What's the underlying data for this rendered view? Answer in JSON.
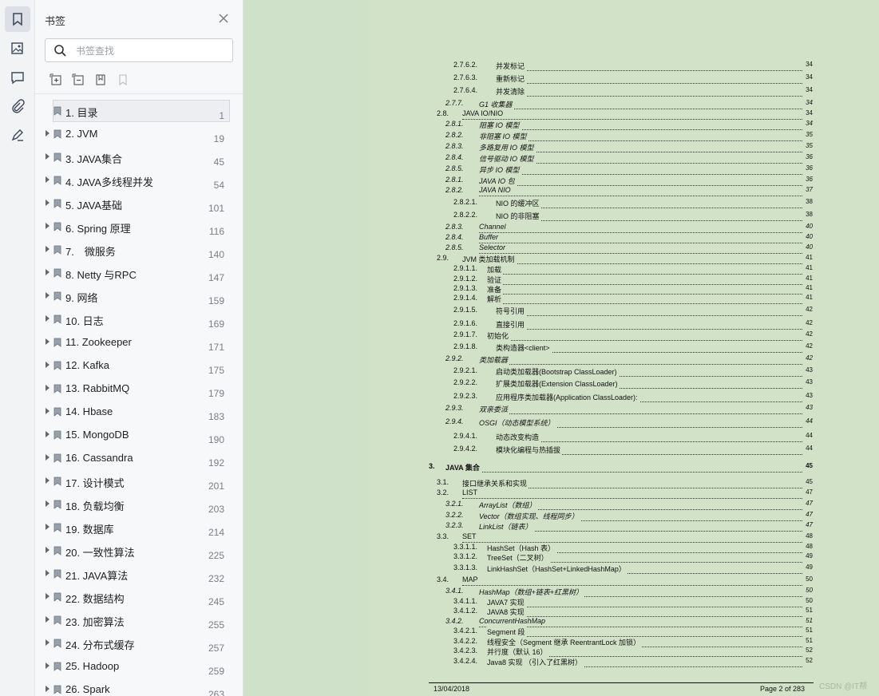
{
  "sidebar_panel": {
    "title": "书签",
    "search_placeholder": "书签查找",
    "bookmarks": [
      {
        "label": "1. 目录",
        "page": "1"
      },
      {
        "label": "2. JVM",
        "page": "19"
      },
      {
        "label": "3. JAVA集合",
        "page": "45"
      },
      {
        "label": "4. JAVA多线程并发",
        "page": "54"
      },
      {
        "label": "5. JAVA基础",
        "page": "101"
      },
      {
        "label": "6. Spring 原理",
        "page": "116"
      },
      {
        "label": "7.　微服务",
        "page": "140"
      },
      {
        "label": "8. Netty 与RPC",
        "page": "147"
      },
      {
        "label": "9. 网络",
        "page": "159"
      },
      {
        "label": "10. 日志",
        "page": "169"
      },
      {
        "label": "11. Zookeeper",
        "page": "171"
      },
      {
        "label": "12. Kafka",
        "page": "175"
      },
      {
        "label": "13. RabbitMQ",
        "page": "179"
      },
      {
        "label": "14. Hbase",
        "page": "183"
      },
      {
        "label": "15. MongoDB",
        "page": "190"
      },
      {
        "label": "16. Cassandra",
        "page": "192"
      },
      {
        "label": "17. 设计模式",
        "page": "201"
      },
      {
        "label": "18. 负载均衡",
        "page": "203"
      },
      {
        "label": "19. 数据库",
        "page": "214"
      },
      {
        "label": "20. 一致性算法",
        "page": "225"
      },
      {
        "label": "21. JAVA算法",
        "page": "232"
      },
      {
        "label": "22. 数据结构",
        "page": "245"
      },
      {
        "label": "23. 加密算法",
        "page": "255"
      },
      {
        "label": "24. 分布式缓存",
        "page": "257"
      },
      {
        "label": "25. Hadoop",
        "page": "259"
      },
      {
        "label": "26. Spark",
        "page": "263"
      }
    ]
  },
  "document": {
    "toc": [
      {
        "num": "2.7.6.2.",
        "title": "并发标记",
        "page": "34",
        "lvl": 4
      },
      {
        "num": "2.7.6.3.",
        "title": "重新标记",
        "page": "34",
        "lvl": 4
      },
      {
        "num": "2.7.6.4.",
        "title": "并发清除",
        "page": "34",
        "lvl": 4
      },
      {
        "num": "2.7.7.",
        "title": "G1 收集器",
        "page": "34",
        "lvl": 3,
        "italic": true
      },
      {
        "num": "2.8.",
        "title": "JAVA IO/NIO",
        "page": "34",
        "lvl": 2
      },
      {
        "num": "2.8.1.",
        "title": "阻塞 IO 模型",
        "page": "34",
        "lvl": 3,
        "italic": true
      },
      {
        "num": "2.8.2.",
        "title": "非阻塞 IO 模型",
        "page": "35",
        "lvl": 3,
        "italic": true
      },
      {
        "num": "2.8.3.",
        "title": "多路复用 IO 模型",
        "page": "35",
        "lvl": 3,
        "italic": true
      },
      {
        "num": "2.8.4.",
        "title": "信号驱动 IO 模型",
        "page": "36",
        "lvl": 3,
        "italic": true
      },
      {
        "num": "2.8.5.",
        "title": "异步 IO 模型",
        "page": "36",
        "lvl": 3,
        "italic": true
      },
      {
        "num": "2.8.1.",
        "title": "JAVA IO 包",
        "page": "36",
        "lvl": 3,
        "italic": true
      },
      {
        "num": "2.8.2.",
        "title": "JAVA NIO",
        "page": "37",
        "lvl": 3,
        "italic": true
      },
      {
        "num": "2.8.2.1.",
        "title": "NIO 的缓冲区",
        "page": "38",
        "lvl": 4
      },
      {
        "num": "2.8.2.2.",
        "title": "NIO 的非阻塞",
        "page": "38",
        "lvl": 4
      },
      {
        "num": "2.8.3.",
        "title": "Channel",
        "page": "40",
        "lvl": 3,
        "italic": true
      },
      {
        "num": "2.8.4.",
        "title": "Buffer",
        "page": "40",
        "lvl": 3,
        "italic": true
      },
      {
        "num": "2.8.5.",
        "title": "Selector",
        "page": "40",
        "lvl": 3,
        "italic": true
      },
      {
        "num": "2.9.",
        "title": "JVM 类加载机制",
        "page": "41",
        "lvl": 2
      },
      {
        "num": "2.9.1.1.",
        "title": "加载",
        "page": "41",
        "lvl": 4,
        "tight": true
      },
      {
        "num": "2.9.1.2.",
        "title": "验证",
        "page": "41",
        "lvl": 4,
        "tight": true
      },
      {
        "num": "2.9.1.3.",
        "title": "准备",
        "page": "41",
        "lvl": 4,
        "tight": true
      },
      {
        "num": "2.9.1.4.",
        "title": "解析",
        "page": "41",
        "lvl": 4,
        "tight": true
      },
      {
        "num": "2.9.1.5.",
        "title": "符号引用",
        "page": "42",
        "lvl": 4
      },
      {
        "num": "2.9.1.6.",
        "title": "直接引用",
        "page": "42",
        "lvl": 4
      },
      {
        "num": "2.9.1.7.",
        "title": "初始化",
        "page": "42",
        "lvl": 4,
        "tight": true
      },
      {
        "num": "2.9.1.8.",
        "title": "类构造器<client>",
        "page": "42",
        "lvl": 4
      },
      {
        "num": "2.9.2.",
        "title": "类加载器",
        "page": "42",
        "lvl": 3,
        "italic": true
      },
      {
        "num": "2.9.2.1.",
        "title": "启动类加载器(Bootstrap ClassLoader)",
        "page": "43",
        "lvl": 4
      },
      {
        "num": "2.9.2.2.",
        "title": "扩展类加载器(Extension ClassLoader)",
        "page": "43",
        "lvl": 4
      },
      {
        "num": "2.9.2.3.",
        "title": "应用程序类加载器(Application ClassLoader):",
        "page": "43",
        "lvl": 4
      },
      {
        "num": "2.9.3.",
        "title": "双亲委派",
        "page": "43",
        "lvl": 3,
        "italic": true
      },
      {
        "num": "2.9.4.",
        "title": "OSGI（动态模型系统）",
        "page": "44",
        "lvl": 3,
        "italic": true
      },
      {
        "num": "2.9.4.1.",
        "title": "动态改变构造",
        "page": "44",
        "lvl": 4
      },
      {
        "num": "2.9.4.2.",
        "title": "模块化编程与热插拔",
        "page": "44",
        "lvl": 4
      },
      {
        "num": "3.",
        "title": "JAVA 集合",
        "page": "45",
        "lvl": 1,
        "bold": true
      },
      {
        "num": "3.1.",
        "title": "接口继承关系和实现",
        "page": "45",
        "lvl": 2
      },
      {
        "num": "3.2.",
        "title": "LIST",
        "page": "47",
        "lvl": 2
      },
      {
        "num": "3.2.1.",
        "title": "ArrayList（数组）",
        "page": "47",
        "lvl": 3,
        "italic": true
      },
      {
        "num": "3.2.2.",
        "title": "Vector（数组实现、线程同步）",
        "page": "47",
        "lvl": 3,
        "italic": true
      },
      {
        "num": "3.2.3.",
        "title": "LinkList（链表）",
        "page": "47",
        "lvl": 3,
        "italic": true
      },
      {
        "num": "3.3.",
        "title": "SET",
        "page": "48",
        "lvl": 2
      },
      {
        "num": "3.3.1.1.",
        "title": "HashSet（Hash 表）",
        "page": "48",
        "lvl": 4,
        "tight": true
      },
      {
        "num": "3.3.1.2.",
        "title": "TreeSet（二叉树）",
        "page": "49",
        "lvl": 4,
        "tight": true
      },
      {
        "num": "3.3.1.3.",
        "title": "LinkHashSet（HashSet+LinkedHashMap）",
        "page": "49",
        "lvl": 4,
        "tight": true
      },
      {
        "num": "3.4.",
        "title": "MAP",
        "page": "50",
        "lvl": 2
      },
      {
        "num": "3.4.1.",
        "title": "HashMap（数组+链表+红黑树）",
        "page": "50",
        "lvl": 3,
        "italic": true
      },
      {
        "num": "3.4.1.1.",
        "title": "JAVA7 实现",
        "page": "50",
        "lvl": 4,
        "tight": true
      },
      {
        "num": "3.4.1.2.",
        "title": "JAVA8 实现",
        "page": "51",
        "lvl": 4,
        "tight": true
      },
      {
        "num": "3.4.2.",
        "title": "ConcurrentHashMap",
        "page": "51",
        "lvl": 3,
        "italic": true
      },
      {
        "num": "3.4.2.1.",
        "title": "Segment 段",
        "page": "51",
        "lvl": 4,
        "tight": true
      },
      {
        "num": "3.4.2.2.",
        "title": "线程安全（Segment 继承 ReentrantLock 加锁）",
        "page": "51",
        "lvl": 4,
        "tight": true
      },
      {
        "num": "3.4.2.3.",
        "title": "并行度（默认 16）",
        "page": "52",
        "lvl": 4,
        "tight": true
      },
      {
        "num": "3.4.2.4.",
        "title": "Java8 实现 （引入了红黑树）",
        "page": "52",
        "lvl": 4,
        "tight": true
      }
    ],
    "footer_date": "13/04/2018",
    "footer_page": "Page 2 of 283"
  },
  "watermark": "CSDN @IT帮"
}
